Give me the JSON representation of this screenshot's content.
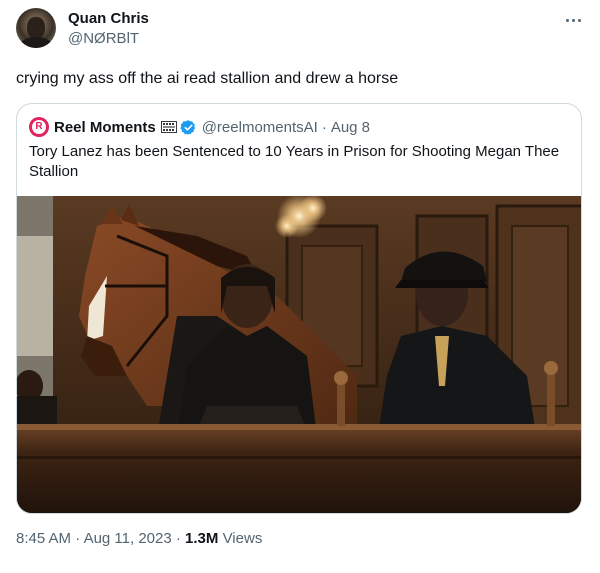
{
  "author": {
    "name": "Quan Chris",
    "handle": "@NØRBlT",
    "avatar_icon": "profile-photo"
  },
  "tweet": {
    "text": "crying my ass off the ai read stallion and drew a horse"
  },
  "quoted": {
    "name": "Reel Moments",
    "handle": "@reelmomentsAI",
    "separator": "·",
    "date": "Aug 8",
    "text": "Tory Lanez has been Sentenced to 10 Years in Prison for Shooting Megan Thee Stallion",
    "avatar_letter": "R",
    "badge_icon": "film-frames-icon",
    "verified_icon": "verified-check-icon",
    "image_description_icon": "courtroom-horse-photo"
  },
  "footer": {
    "time": "8:45 AM",
    "sep1": "·",
    "date": "Aug 11, 2023",
    "sep2": "·",
    "views_count": "1.3M",
    "views_label": "Views"
  },
  "colors": {
    "text_primary": "#0f1419",
    "text_secondary": "#536471",
    "border": "#cfd9de",
    "verified": "#1d9bf0",
    "brand_red": "#e0245e"
  }
}
